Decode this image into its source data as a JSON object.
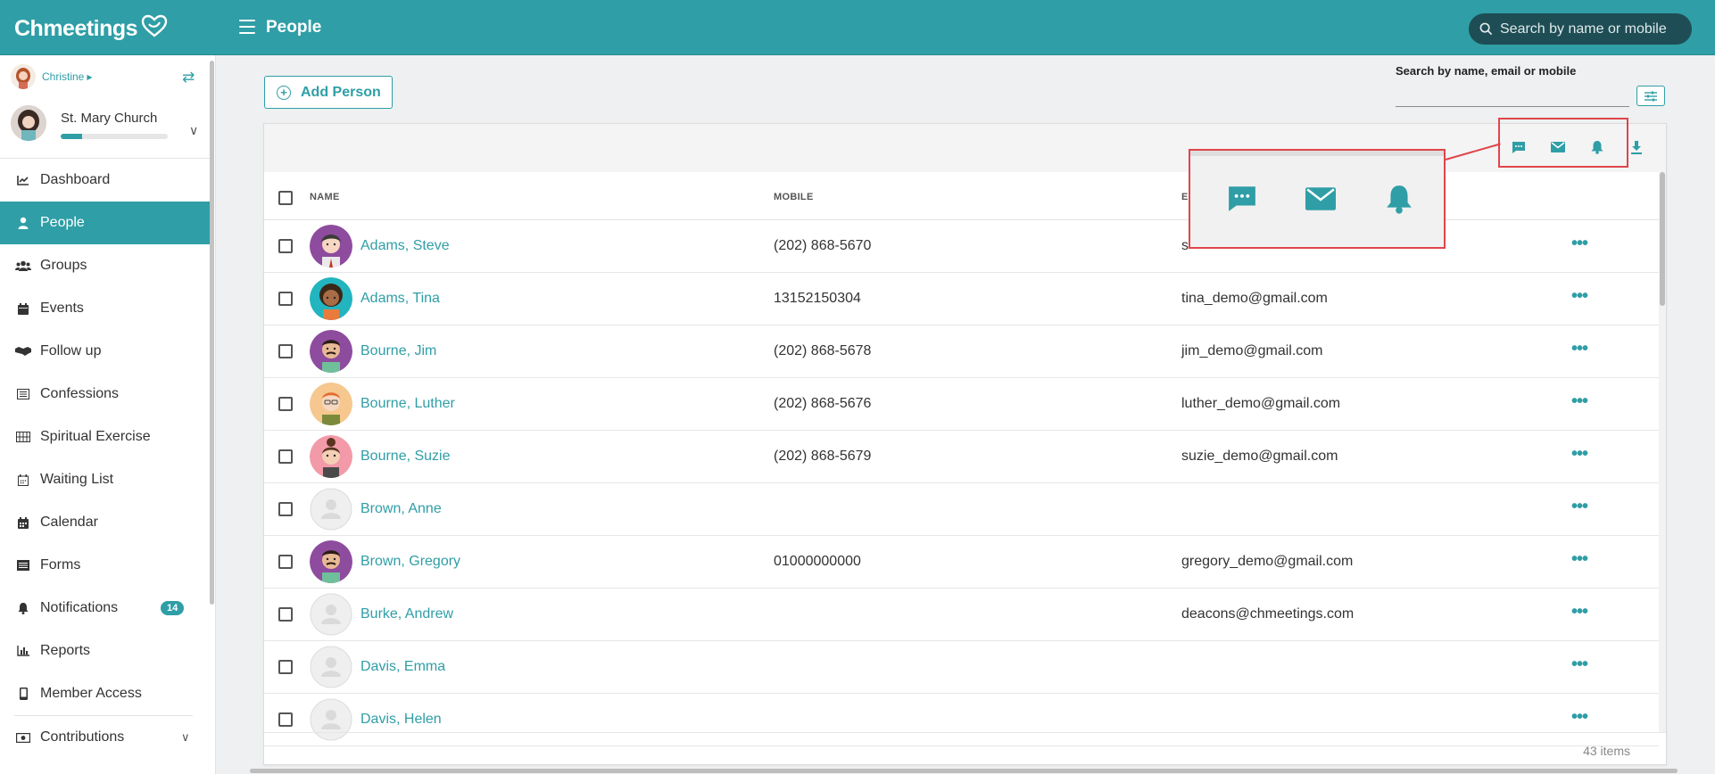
{
  "app": {
    "logo_text": "Chmeetings",
    "page_title": "People",
    "top_search_placeholder": "Search by name or mobile"
  },
  "colors": {
    "accent": "#2f9ea6",
    "highlight": "#e0454b"
  },
  "sidebar": {
    "user_name": "Christine",
    "church_name": "St. Mary Church",
    "items": [
      {
        "label": "Dashboard",
        "icon": "chart-line-icon"
      },
      {
        "label": "People",
        "icon": "person-icon",
        "active": true
      },
      {
        "label": "Groups",
        "icon": "users-icon"
      },
      {
        "label": "Events",
        "icon": "calendar-icon"
      },
      {
        "label": "Follow up",
        "icon": "handshake-icon"
      },
      {
        "label": "Confessions",
        "icon": "list-icon"
      },
      {
        "label": "Spiritual Exercise",
        "icon": "grid-icon"
      },
      {
        "label": "Waiting List",
        "icon": "calendar-icon"
      },
      {
        "label": "Calendar",
        "icon": "calendar-icon"
      },
      {
        "label": "Forms",
        "icon": "list-icon"
      },
      {
        "label": "Notifications",
        "icon": "bell-icon",
        "badge": "14"
      },
      {
        "label": "Reports",
        "icon": "bar-chart-icon"
      },
      {
        "label": "Member Access",
        "icon": "mobile-icon"
      },
      {
        "label": "Contributions",
        "icon": "money-icon",
        "expandable": true
      }
    ]
  },
  "main": {
    "add_person_label": "Add Person",
    "filter_label": "Search by name, email or mobile",
    "toolbar_icons": [
      "sms-icon",
      "email-icon",
      "bell-icon",
      "download-icon"
    ],
    "columns": {
      "name": "NAME",
      "mobile": "MOBILE",
      "email": "E"
    },
    "rows": [
      {
        "name": "Adams, Steve",
        "mobile": "(202) 868-5670",
        "email": "s",
        "avatar": "purple"
      },
      {
        "name": "Adams, Tina",
        "mobile": "13152150304",
        "email": "tina_demo@gmail.com",
        "avatar": "teal"
      },
      {
        "name": "Bourne, Jim",
        "mobile": "(202) 868-5678",
        "email": "jim_demo@gmail.com",
        "avatar": "purple"
      },
      {
        "name": "Bourne, Luther",
        "mobile": "(202) 868-5676",
        "email": "luther_demo@gmail.com",
        "avatar": "orange"
      },
      {
        "name": "Bourne, Suzie",
        "mobile": "(202) 868-5679",
        "email": "suzie_demo@gmail.com",
        "avatar": "pink"
      },
      {
        "name": "Brown, Anne",
        "mobile": "",
        "email": "",
        "avatar": "blank"
      },
      {
        "name": "Brown, Gregory",
        "mobile": "01000000000",
        "email": "gregory_demo@gmail.com",
        "avatar": "purple"
      },
      {
        "name": "Burke, Andrew",
        "mobile": "",
        "email": "deacons@chmeetings.com",
        "avatar": "blank"
      },
      {
        "name": "Davis, Emma",
        "mobile": "",
        "email": "",
        "avatar": "blank"
      },
      {
        "name": "Davis, Helen",
        "mobile": "",
        "email": "",
        "avatar": "blank"
      }
    ],
    "items_count": "43 items"
  },
  "callout": {
    "icons": [
      "sms-icon",
      "email-icon",
      "bell-icon"
    ]
  }
}
